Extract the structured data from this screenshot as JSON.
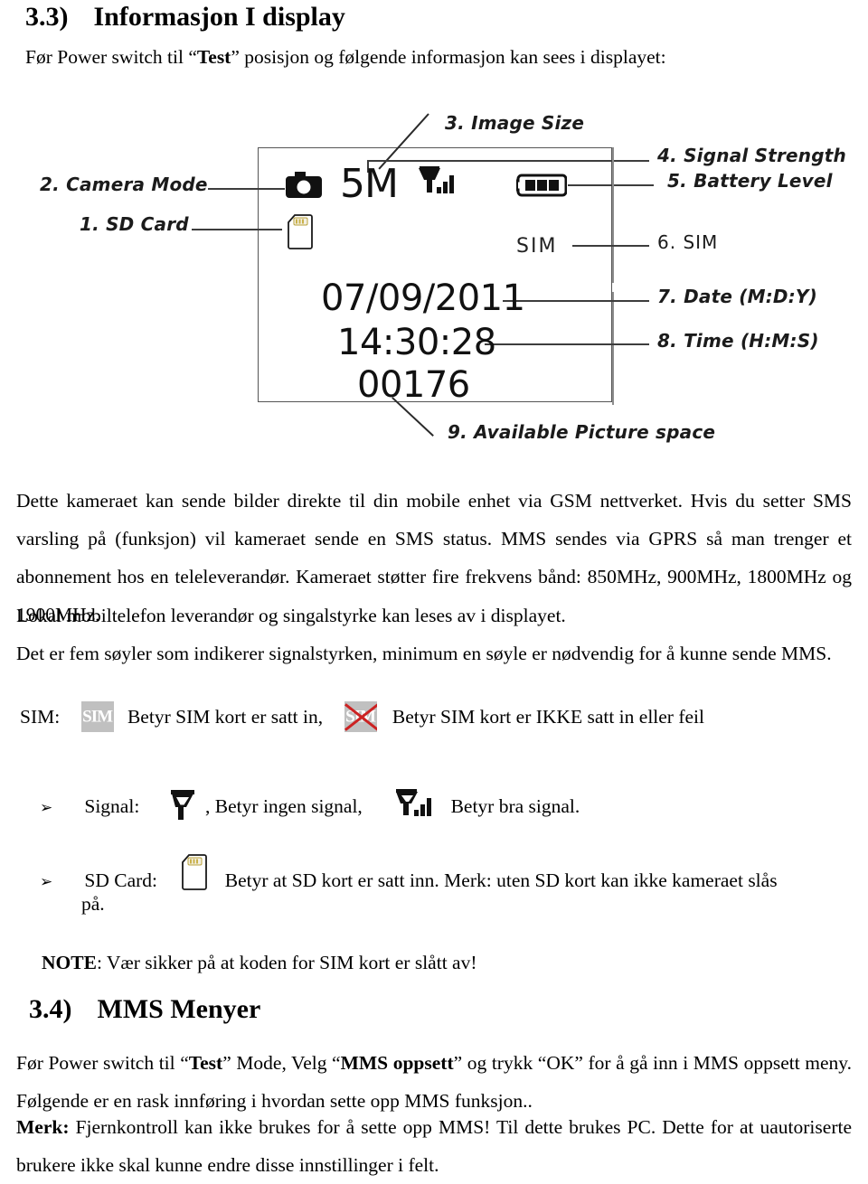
{
  "section_3_3": {
    "number": "3.3)",
    "title": "Informasjon I display",
    "intro_prefix": "Før Power switch til “",
    "intro_bold": "Test",
    "intro_suffix": "” posisjon og følgende informasjon kan sees i displayet:"
  },
  "figure": {
    "callouts": [
      {
        "key": "sd_card",
        "label": "1. SD Card"
      },
      {
        "key": "camera_mode",
        "label": "2. Camera Mode"
      },
      {
        "key": "image_size",
        "label": "3. Image Size"
      },
      {
        "key": "signal",
        "label": "4. Signal Strength"
      },
      {
        "key": "battery",
        "label": "5. Battery Level"
      },
      {
        "key": "sim",
        "label": "6. SIM"
      },
      {
        "key": "date",
        "label": "7. Date (M:D:Y)"
      },
      {
        "key": "time",
        "label": "8. Time (H:M:S)"
      },
      {
        "key": "picture_space",
        "label": "9. Available Picture space"
      }
    ],
    "display": {
      "image_size": "5M",
      "sim_label": "SIM",
      "date": "07/09/2011",
      "time": "14:30:28",
      "picture_count": "00176",
      "icons": [
        "camera-mode-icon",
        "sd-card-icon",
        "signal-strength-icon",
        "battery-level-icon"
      ]
    }
  },
  "body": {
    "p1": "Dette kameraet kan sende bilder direkte til din mobile enhet via GSM nettverket. Hvis du setter SMS varsling på (funksjon) vil kameraet sende en SMS status. MMS sendes via GPRS så man trenger et abonnement hos en teleleverandør. Kameraet støtter fire frekvens bånd: 850MHz, 900MHz, 1800MHz og 1900MHz.",
    "p2": "Lokal mobiltelefon leverandør og singalstyrke kan leses av i displayet.",
    "p3": "Det er fem søyler som indikerer signalstyrken, minimum en søyle er nødvendig for å kunne sende MMS."
  },
  "sim_line": {
    "prefix": "SIM:",
    "chip_ok_text": "SIM",
    "text_ok": "Betyr SIM kort er satt in,",
    "chip_bad_text": "SIM",
    "text_bad": "Betyr SIM kort er IKKE satt in eller feil"
  },
  "signal_line": {
    "bullet": "➢",
    "prefix": "Signal:",
    "text_no_signal": ", Betyr ingen signal,",
    "text_good_signal": "Betyr bra signal."
  },
  "sd_line": {
    "bullet": "➢",
    "prefix": "SD Card:",
    "text": "Betyr at SD kort er satt inn. Merk: uten SD kort kan ikke kameraet slås",
    "text_cont": "på."
  },
  "note": {
    "label": "NOTE",
    "text": ": Vær sikker på at koden for SIM kort er slått av!"
  },
  "section_3_4": {
    "number": "3.4)",
    "title": "MMS Menyer",
    "p1_a": "Før Power switch til “",
    "p1_b": "Test",
    "p1_c": "” Mode, Velg “",
    "p1_d": "MMS oppsett",
    "p1_e": "” og trykk “OK” for å gå inn i MMS oppsett meny. Følgende er en rask innføring i hvordan sette opp MMS funksjon..",
    "p2_label": "Merk:",
    "p2_text": " Fjernkontroll kan ikke brukes for å sette opp MMS! Til dette brukes PC. Dette for at uautoriserte brukere ikke skal kunne endre disse innstillinger i felt."
  }
}
